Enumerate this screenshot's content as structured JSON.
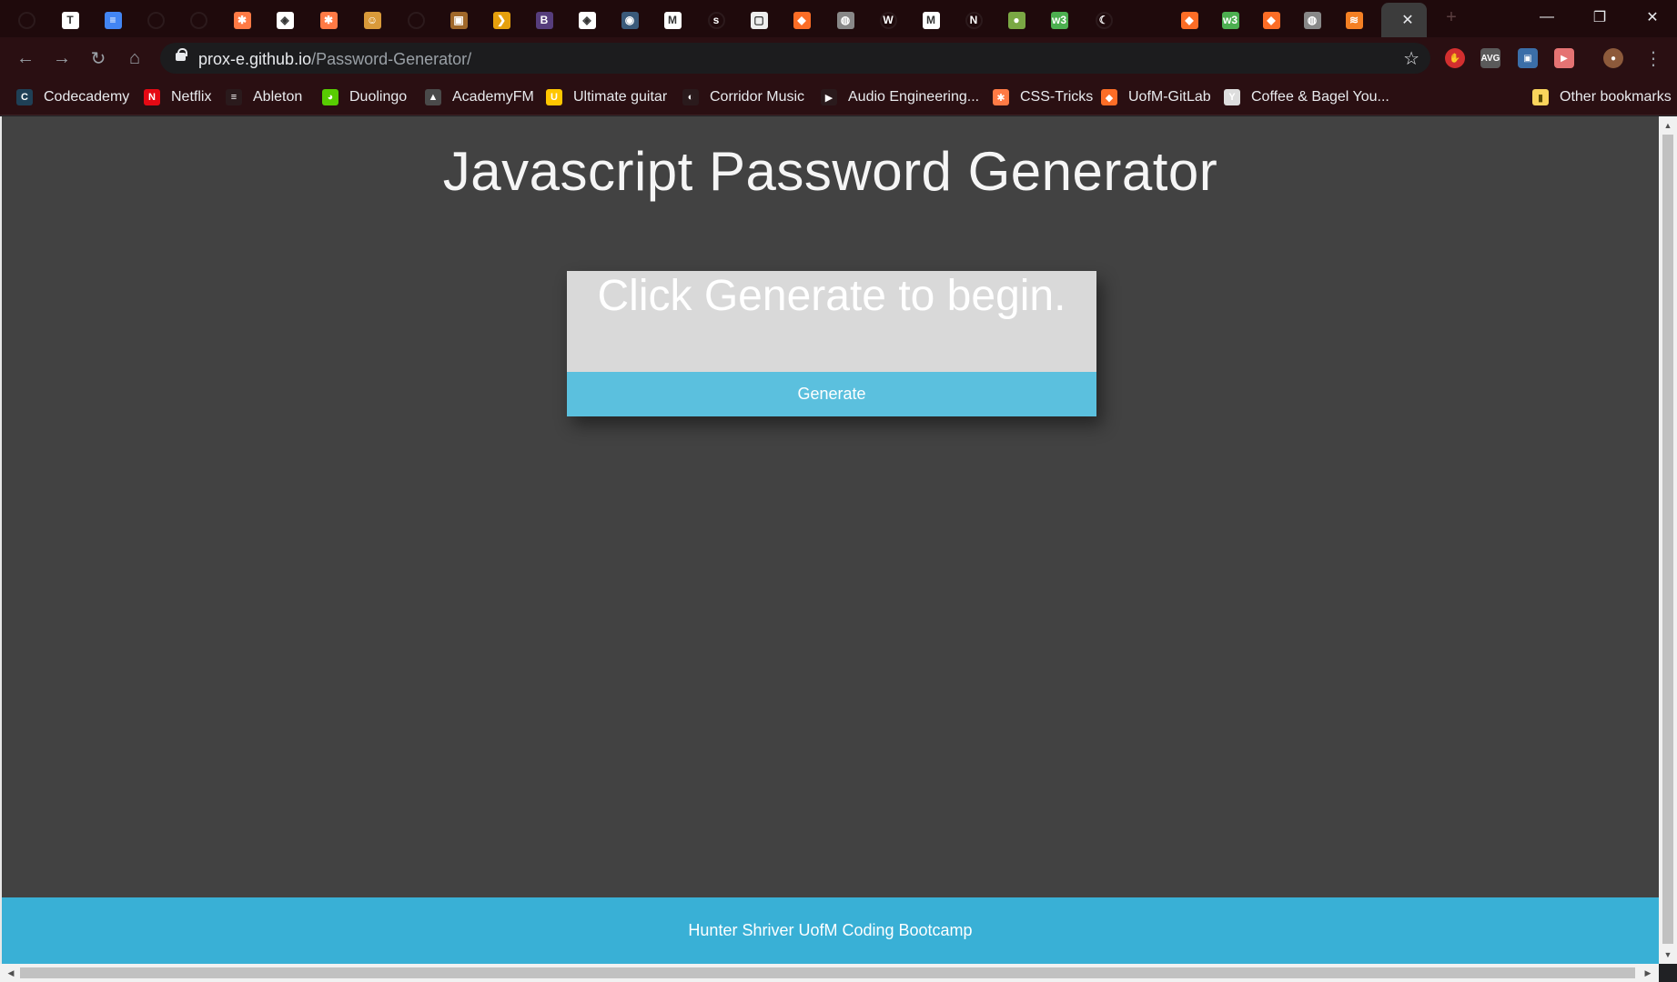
{
  "browser": {
    "tabs": [
      {
        "icon": "github-icon",
        "color": "#2a1a1c",
        "glyph": ""
      },
      {
        "icon": "notion-icon",
        "color": "#ffffff",
        "glyph": "T"
      },
      {
        "icon": "google-docs-icon",
        "color": "#4285f4",
        "glyph": "≡"
      },
      {
        "icon": "github-icon",
        "color": "#2a1a1c",
        "glyph": ""
      },
      {
        "icon": "github-icon",
        "color": "#2a1a1c",
        "glyph": ""
      },
      {
        "icon": "css-tricks-icon",
        "color": "#ff7a45",
        "glyph": "✱"
      },
      {
        "icon": "codepen-icon",
        "color": "#ffffff",
        "glyph": "◈"
      },
      {
        "icon": "css-tricks-icon",
        "color": "#ff7a45",
        "glyph": "✱"
      },
      {
        "icon": "image-icon",
        "color": "#d99a3a",
        "glyph": "☺"
      },
      {
        "icon": "github-icon",
        "color": "#2a1a1c",
        "glyph": ""
      },
      {
        "icon": "image-icon",
        "color": "#a0682a",
        "glyph": "▣"
      },
      {
        "icon": "plex-icon",
        "color": "#e5a00d",
        "glyph": "❯"
      },
      {
        "icon": "bootstrap-icon",
        "color": "#563d7c",
        "glyph": "B"
      },
      {
        "icon": "codepen-icon",
        "color": "#ffffff",
        "glyph": "◈"
      },
      {
        "icon": "app-icon",
        "color": "#3a5a7a",
        "glyph": "◉"
      },
      {
        "icon": "gmail-icon",
        "color": "#ffffff",
        "glyph": "M"
      },
      {
        "icon": "slack-icon",
        "color": "#2a1a1c",
        "glyph": "s"
      },
      {
        "icon": "page-icon",
        "color": "#eeeeee",
        "glyph": "▢"
      },
      {
        "icon": "gitlab-icon",
        "color": "#fc6d26",
        "glyph": "◆"
      },
      {
        "icon": "globe-icon",
        "color": "#888888",
        "glyph": "◍"
      },
      {
        "icon": "w-icon",
        "color": "#2a1a1c",
        "glyph": "W"
      },
      {
        "icon": "gmail-icon",
        "color": "#ffffff",
        "glyph": "M"
      },
      {
        "icon": "n-icon",
        "color": "#2a1a1c",
        "glyph": "N"
      },
      {
        "icon": "leaf-icon",
        "color": "#7aa844",
        "glyph": "●"
      },
      {
        "icon": "w3schools-icon",
        "color": "#4caf50",
        "glyph": "w3"
      },
      {
        "icon": "wave-icon",
        "color": "#2a1a1c",
        "glyph": "☾"
      },
      {
        "icon": "gitlab-icon",
        "color": "#fc6d26",
        "glyph": "◆"
      },
      {
        "icon": "w3schools-icon",
        "color": "#4caf50",
        "glyph": "w3"
      },
      {
        "icon": "gitlab-icon",
        "color": "#fc6d26",
        "glyph": "◆"
      },
      {
        "icon": "globe-icon",
        "color": "#888888",
        "glyph": "◍"
      },
      {
        "icon": "stackoverflow-icon",
        "color": "#f48024",
        "glyph": "≋"
      }
    ],
    "active_tab_close": "✕",
    "new_tab": "+",
    "window": {
      "minimize": "—",
      "maximize": "❐",
      "close": "✕"
    },
    "address": {
      "domain": "prox-e.github.io",
      "path": "/Password-Generator/"
    },
    "bookmarks": [
      {
        "label": "Codecademy",
        "icon": "codecademy-icon",
        "color": "#1f4056",
        "glyph": "C"
      },
      {
        "label": "Netflix",
        "icon": "netflix-icon",
        "color": "#e50914",
        "glyph": "N"
      },
      {
        "label": "Ableton",
        "icon": "ableton-icon",
        "color": "#2a1a1c",
        "glyph": "≡"
      },
      {
        "label": "Duolingo",
        "icon": "duolingo-icon",
        "color": "#58cc02",
        "glyph": "◕"
      },
      {
        "label": "AcademyFM",
        "icon": "academyfm-icon",
        "color": "#4a4a4a",
        "glyph": "▲"
      },
      {
        "label": "Ultimate guitar",
        "icon": "ultimate-guitar-icon",
        "color": "#ffc600",
        "glyph": "U"
      },
      {
        "label": "Corridor Music",
        "icon": "corridor-icon",
        "color": "#2a1a1c",
        "glyph": "◐"
      },
      {
        "label": "Audio Engineering...",
        "icon": "video-icon",
        "color": "#2a1a1c",
        "glyph": "▶"
      },
      {
        "label": "CSS-Tricks",
        "icon": "css-tricks-icon",
        "color": "#ff7a45",
        "glyph": "✱"
      },
      {
        "label": "UofM-GitLab",
        "icon": "gitlab-icon",
        "color": "#fc6d26",
        "glyph": "◆"
      },
      {
        "label": "Coffee & Bagel You...",
        "icon": "youtube-icon",
        "color": "#dddddd",
        "glyph": "Y"
      }
    ],
    "other_bookmarks": "Other bookmarks"
  },
  "page": {
    "title": "Javascript Password Generator",
    "password_placeholder": "Click Generate to begin.",
    "generate_label": "Generate",
    "footer": "Hunter Shriver UofM Coding Bootcamp"
  },
  "colors": {
    "page_bg": "#424242",
    "card_bg": "#d9d9d9",
    "button_bg": "#5bc0de",
    "footer_bg": "#39b0d6",
    "chrome_bg": "#2a0f12"
  }
}
